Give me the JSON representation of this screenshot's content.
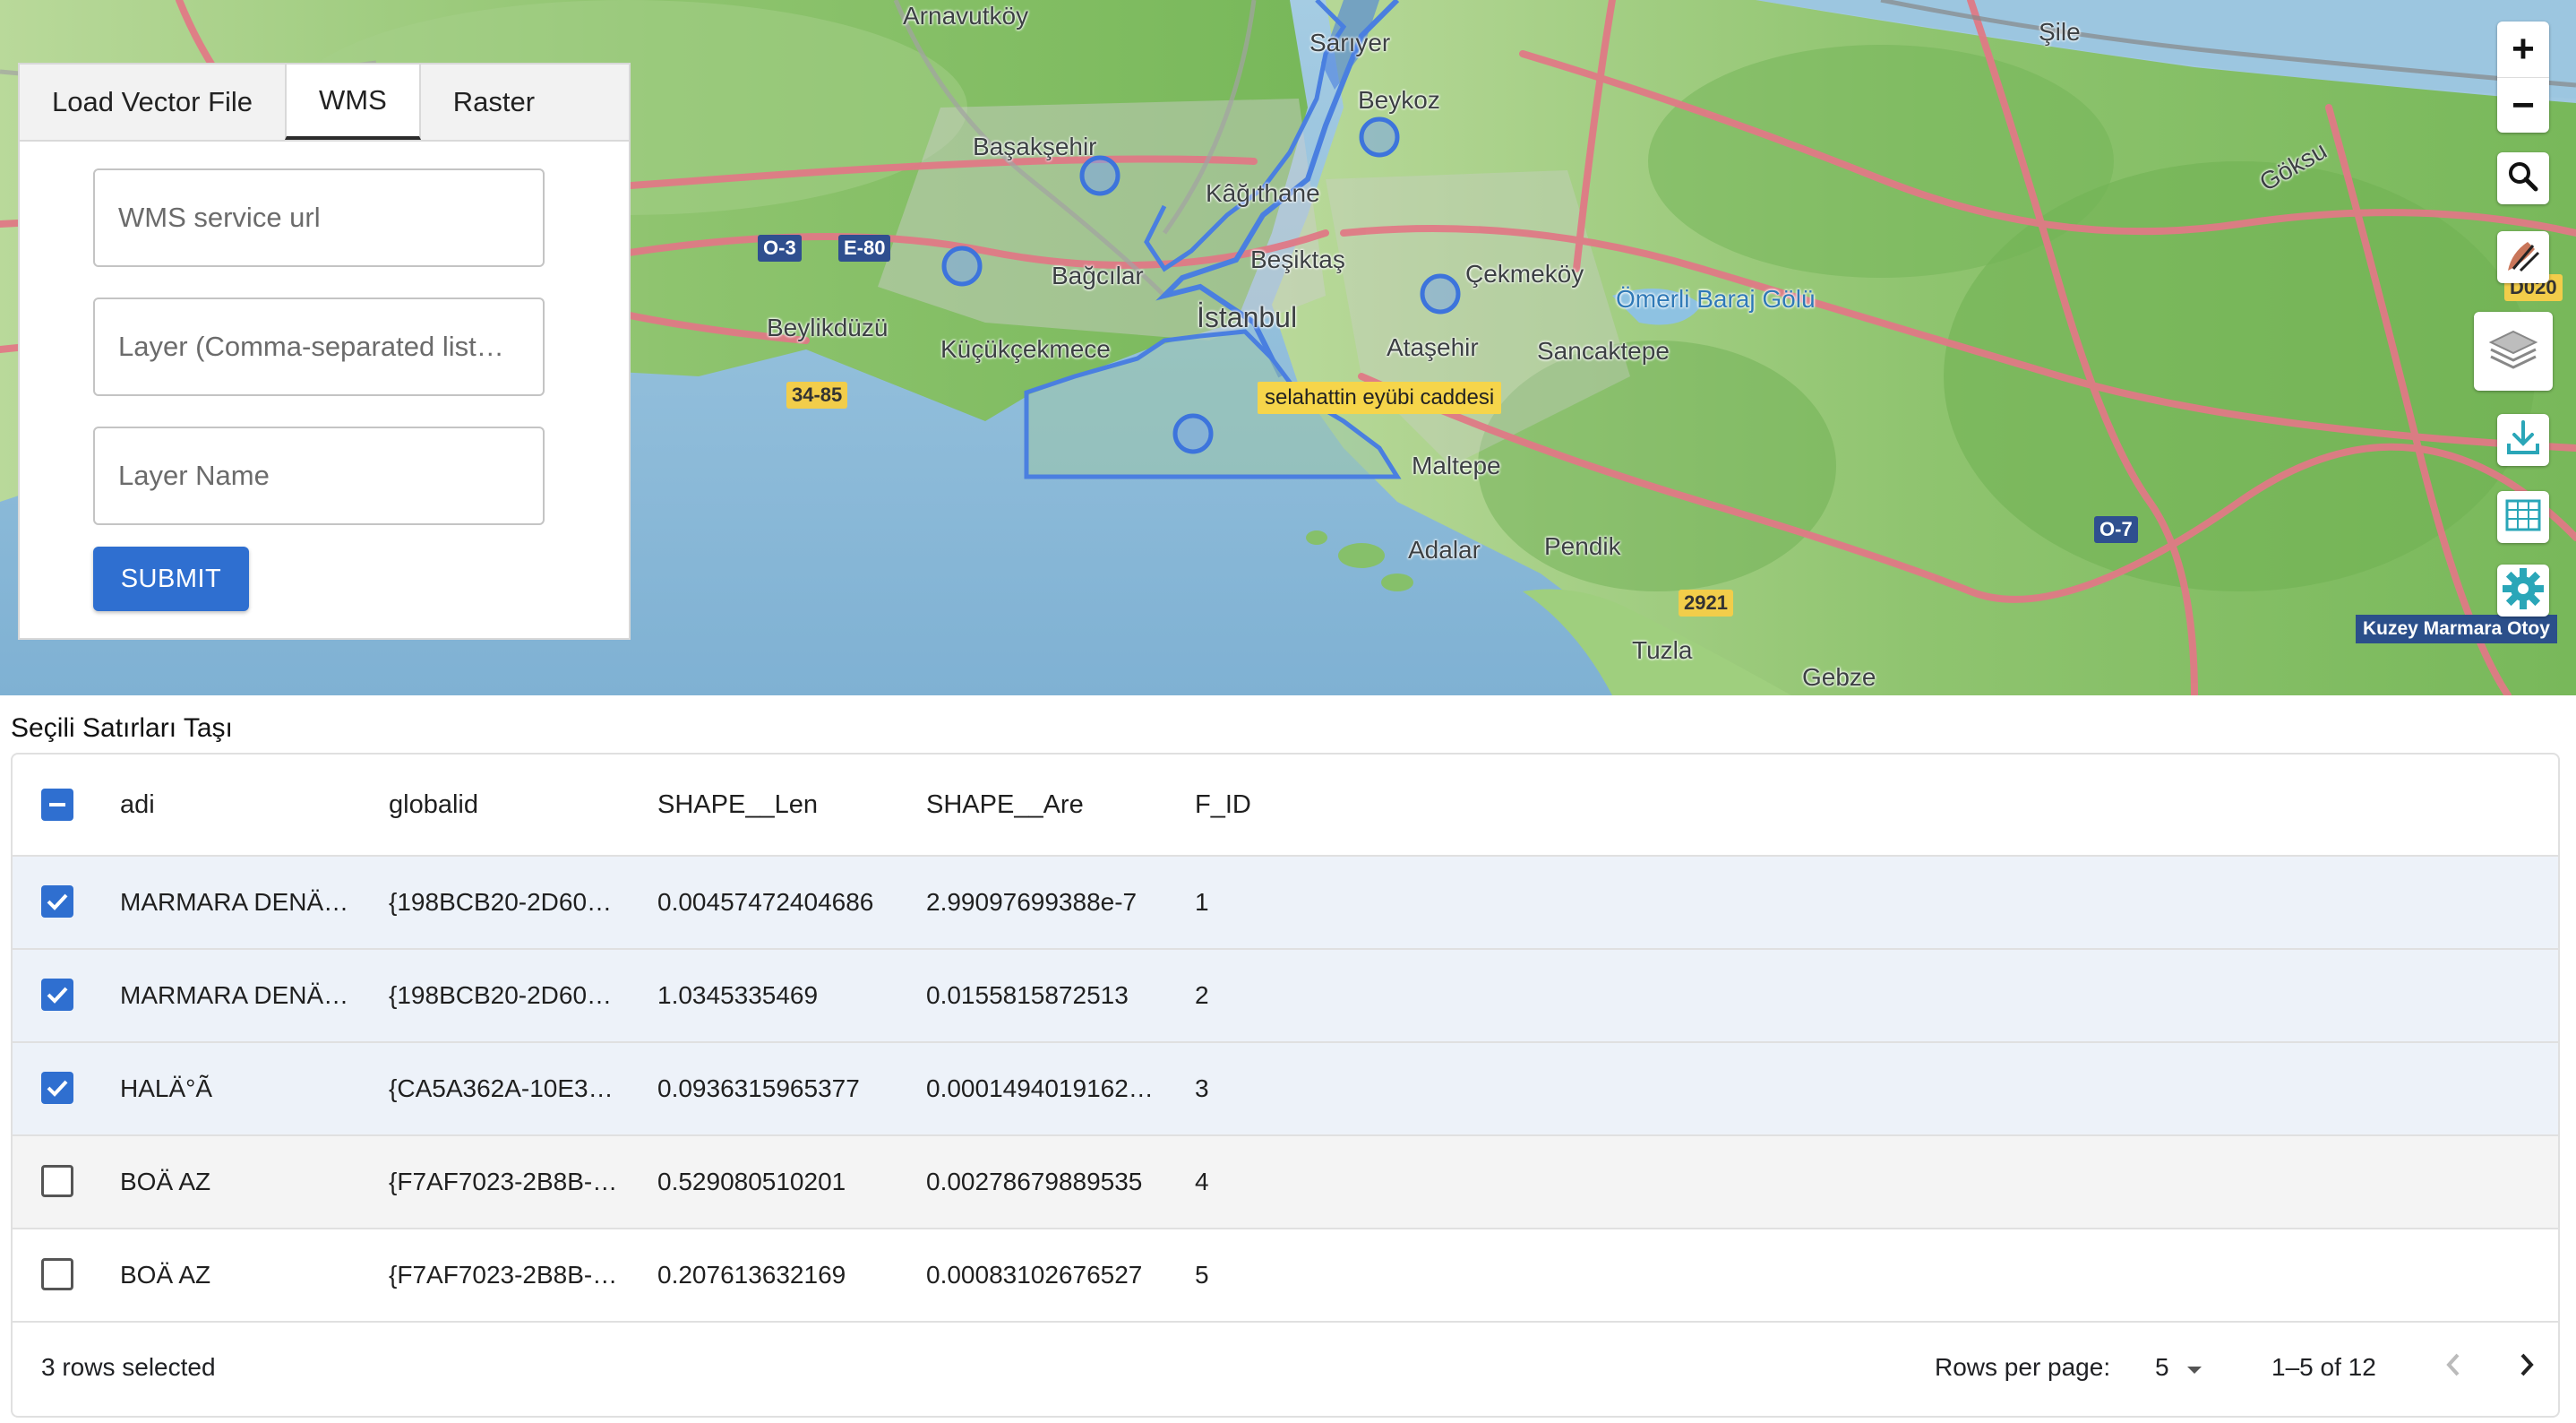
{
  "map": {
    "places": [
      {
        "name": "Arnavutköy"
      },
      {
        "name": "Sarıyer"
      },
      {
        "name": "Şile"
      },
      {
        "name": "Beykoz"
      },
      {
        "name": "Başakşehir"
      },
      {
        "name": "Kâğıthane"
      },
      {
        "name": "Göksu"
      },
      {
        "name": "Bağcılar"
      },
      {
        "name": "Beşiktaş"
      },
      {
        "name": "Çekmeköy"
      },
      {
        "name": "Ömerli Baraj Gölü"
      },
      {
        "name": "Beylikdüzü"
      },
      {
        "name": "İstanbul"
      },
      {
        "name": "Küçükçekmece"
      },
      {
        "name": "Ataşehir"
      },
      {
        "name": "Sancaktepe"
      },
      {
        "name": "Maltepe"
      },
      {
        "name": "Adalar"
      },
      {
        "name": "Pendik"
      },
      {
        "name": "Tuzla"
      },
      {
        "name": "Gebze"
      }
    ],
    "shields": [
      "O-3",
      "E-80",
      "34-85",
      "2921",
      "O-7",
      "D020"
    ],
    "tooltip": "selahattin eyübi caddesi",
    "road_label": "Kuzey Marmara Otoy",
    "controls": {
      "zoom_in": "+",
      "zoom_out": "−",
      "icons": [
        "search-icon",
        "draw-icon",
        "layers-icon",
        "download-icon",
        "table-icon",
        "settings-icon"
      ]
    }
  },
  "panel": {
    "tabs": [
      "Load Vector File",
      "WMS",
      "Raster"
    ],
    "active_tab": "WMS",
    "fields": {
      "url_placeholder": "WMS service url",
      "layer_placeholder": "Layer (Comma-separated list…",
      "name_placeholder": "Layer Name"
    },
    "submit_label": "SUBMIT"
  },
  "table": {
    "title": "Seçili Satırları Taşı",
    "columns": [
      "adi",
      "globalid",
      "SHAPE__Len",
      "SHAPE__Are",
      "F_ID"
    ],
    "rows": [
      {
        "checked": true,
        "adi": "MARMARA DENÄ…",
        "globalid": "{198BCB20-2D60…",
        "len": "0.00457472404686",
        "are": "2.99097699388e-7",
        "fid": "1"
      },
      {
        "checked": true,
        "adi": "MARMARA DENÄ…",
        "globalid": "{198BCB20-2D60…",
        "len": "1.0345335469",
        "are": "0.0155815872513",
        "fid": "2"
      },
      {
        "checked": true,
        "adi": "HALÄ°Ã",
        "globalid": "{CA5A362A-10E3…",
        "len": "0.0936315965377",
        "are": "0.0001494019162…",
        "fid": "3"
      },
      {
        "checked": false,
        "adi": "BOÄ   AZ",
        "globalid": "{F7AF7023-2B8B-…",
        "len": "0.529080510201",
        "are": "0.00278679889535",
        "fid": "4"
      },
      {
        "checked": false,
        "adi": "BOÄ   AZ",
        "globalid": "{F7AF7023-2B8B-…",
        "len": "0.207613632169",
        "are": "0.00083102676527",
        "fid": "5"
      }
    ],
    "footer": {
      "selected_text": "3 rows selected",
      "rows_per_page_label": "Rows per page:",
      "rows_per_page": "5",
      "range": "1–5 of 12"
    }
  },
  "colors": {
    "accent": "#2f6fd0",
    "selected_row": "#edf2f9",
    "land": "#8cc46a",
    "sea": "#8bbbd8",
    "road": "#e07a86",
    "vector": "#4a7fe0"
  }
}
